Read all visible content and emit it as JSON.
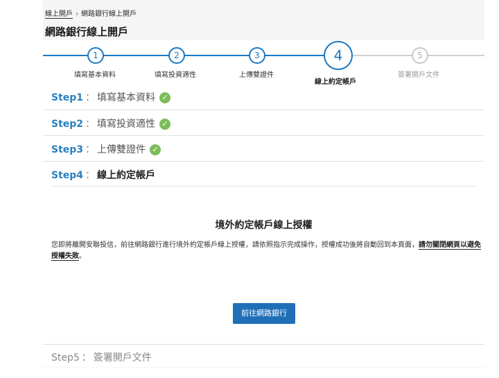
{
  "breadcrumb": {
    "items": [
      "線上開戶",
      "網路銀行線上開戶"
    ],
    "separator": "›"
  },
  "page_title": "網路銀行線上開戶",
  "stepper": {
    "steps": [
      {
        "number": "1",
        "label": "填寫基本資料",
        "state": "done"
      },
      {
        "number": "2",
        "label": "填寫投資適性",
        "state": "done"
      },
      {
        "number": "3",
        "label": "上傳雙證件",
        "state": "done"
      },
      {
        "number": "4",
        "label": "線上約定帳戶",
        "state": "active"
      },
      {
        "number": "5",
        "label": "簽署開戶文件",
        "state": "todo"
      }
    ],
    "active_color": "#1a78c2",
    "todo_color": "#c8c8c8"
  },
  "sections": {
    "step1": {
      "num": "Step1",
      "colon": "：",
      "name": "填寫基本資料",
      "status": "check-icon"
    },
    "step2": {
      "num": "Step2",
      "colon": "：",
      "name": "填寫投資適性",
      "status": "check-icon"
    },
    "step3": {
      "num": "Step3",
      "colon": "：",
      "name": "上傳雙證件",
      "status": "check-icon"
    },
    "step4": {
      "num": "Step4",
      "colon": "：",
      "name": "線上約定帳戶"
    },
    "step5": {
      "num": "Step5",
      "colon": "：",
      "name": "簽署開戶文件"
    }
  },
  "authorization": {
    "title": "境外約定帳戶線上授權",
    "text": "您即將離開安聯投信，前往網路銀行進行境外約定帳戶線上授權，請依照指示完成操作，授權成功後將自動回到本頁面，",
    "warning": "請勿關閉網頁以避免授權失敗",
    "text_end": "。",
    "button_label": "前往網路銀行"
  },
  "colors": {
    "accent": "#2a7fc0",
    "check_green": "#7cbc59",
    "button_blue": "#1f6fb8"
  }
}
